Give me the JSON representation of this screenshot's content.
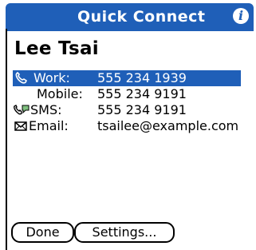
{
  "header": {
    "title": "Quick Connect",
    "info_icon": "info-icon"
  },
  "contact": {
    "name": "Lee Tsai"
  },
  "entries": [
    {
      "icon": "phone-icon",
      "label": "Work:",
      "value": "555 234 1939",
      "selected": true
    },
    {
      "icon": "",
      "label": "Mobile:",
      "value": "555 234 9191",
      "selected": false
    },
    {
      "icon": "sms-icon",
      "label": "SMS:",
      "value": "555 234 9191",
      "selected": false
    },
    {
      "icon": "envelope-icon",
      "label": "Email:",
      "value": "tsailee@example.com",
      "selected": false
    }
  ],
  "buttons": {
    "done": "Done",
    "settings": "Settings..."
  },
  "colors": {
    "accent": "#1f5fb8"
  }
}
